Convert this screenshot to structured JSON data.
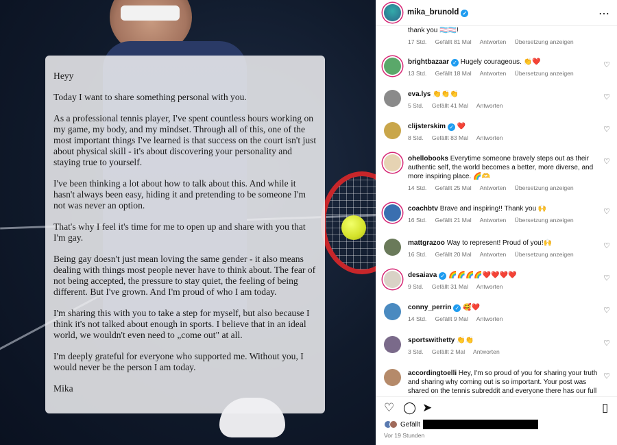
{
  "letter": {
    "paragraphs": [
      "Heyy",
      "Today I want to share something personal with you.",
      "As a professional tennis player, I've spent countless hours working on my game, my body, and my mindset. Through all of this, one of the most important things I've learned is that success on the court isn't just about physical skill - it's about discovering your personality and staying true to yourself.",
      "I've been thinking a lot about how to talk about this. And while it hasn't always been easy, hiding it and pretending to be someone I'm not was never an option.",
      "That's why I feel it's time for me to open up and share with you that I'm gay.",
      "Being gay doesn't just mean loving the same gender - it also means dealing with things most people never have to think about. The fear of not being accepted, the pressure to stay quiet, the feeling of being different. But I've grown. And I'm proud of who I am today.",
      "I'm sharing this with you to take a step for myself, but also because I think it's not talked about enough in sports. I believe that in an ideal world, we wouldn't even need to „come out\" at all.",
      "I'm deeply grateful for everyone who supported me. Without you, I would never be the person I am today.",
      "Mika"
    ]
  },
  "header": {
    "username": "mika_brunold",
    "more_icon": "⋯"
  },
  "comments": [
    {
      "user": "",
      "text": "thank you 🏳️‍⚧️🏳️‍⚧️!",
      "time": "17 Std.",
      "likes": "Gefällt 81 Mal",
      "reply": "Antworten",
      "translate": "Übersetzung anzeigen"
    },
    {
      "user": "brightbazaar",
      "text": "Hugely courageous. 👏❤️",
      "time": "13 Std.",
      "likes": "Gefällt 18 Mal",
      "reply": "Antworten",
      "translate": "Übersetzung anzeigen"
    },
    {
      "user": "eva.lys",
      "text": "👏👏👏",
      "time": "5 Std.",
      "likes": "Gefällt 41 Mal",
      "reply": "Antworten",
      "translate": ""
    },
    {
      "user": "clijsterskim",
      "text": "❤️",
      "time": "8 Std.",
      "likes": "Gefällt 83 Mal",
      "reply": "Antworten",
      "translate": ""
    },
    {
      "user": "ohellobooks",
      "text": "Everytime someone bravely steps out as their authentic self, the world becomes a better, more diverse, and more inspiring place. 🌈🫶",
      "time": "14 Std.",
      "likes": "Gefällt 25 Mal",
      "reply": "Antworten",
      "translate": "Übersetzung anzeigen"
    },
    {
      "user": "coachbtv",
      "text": "Brave and inspiring!! Thank you 🙌",
      "time": "16 Std.",
      "likes": "Gefällt 21 Mal",
      "reply": "Antworten",
      "translate": "Übersetzung anzeigen"
    },
    {
      "user": "mattgrazoo",
      "text": "Way to represent! Proud of you!🙌",
      "time": "16 Std.",
      "likes": "Gefällt 20 Mal",
      "reply": "Antworten",
      "translate": "Übersetzung anzeigen"
    },
    {
      "user": "desaiava",
      "text": "🌈🌈🌈🌈❤️❤️❤️❤️",
      "time": "9 Std.",
      "likes": "Gefällt 31 Mal",
      "reply": "Antworten",
      "translate": ""
    },
    {
      "user": "conny_perrin",
      "text": "🥰❤️",
      "time": "14 Std.",
      "likes": "Gefällt 9 Mal",
      "reply": "Antworten",
      "translate": ""
    },
    {
      "user": "sportswithetty",
      "text": "👏👏",
      "time": "3 Std.",
      "likes": "Gefällt 2 Mal",
      "reply": "Antworten",
      "translate": ""
    },
    {
      "user": "accordingtoelli",
      "text": "Hey, I'm so proud of you for sharing your truth and sharing why coming out is so important. Your post was shared on the tennis subreddit and everyone there has our full",
      "time": "",
      "likes": "",
      "reply": "",
      "translate": ""
    }
  ],
  "footer": {
    "likes_prefix": "Gefällt",
    "time_ago": "Vor 19 Stunden"
  },
  "colors": {
    "verified": "#1f9cf0",
    "story_ring": "#d62976",
    "meta_gray": "#737373"
  }
}
